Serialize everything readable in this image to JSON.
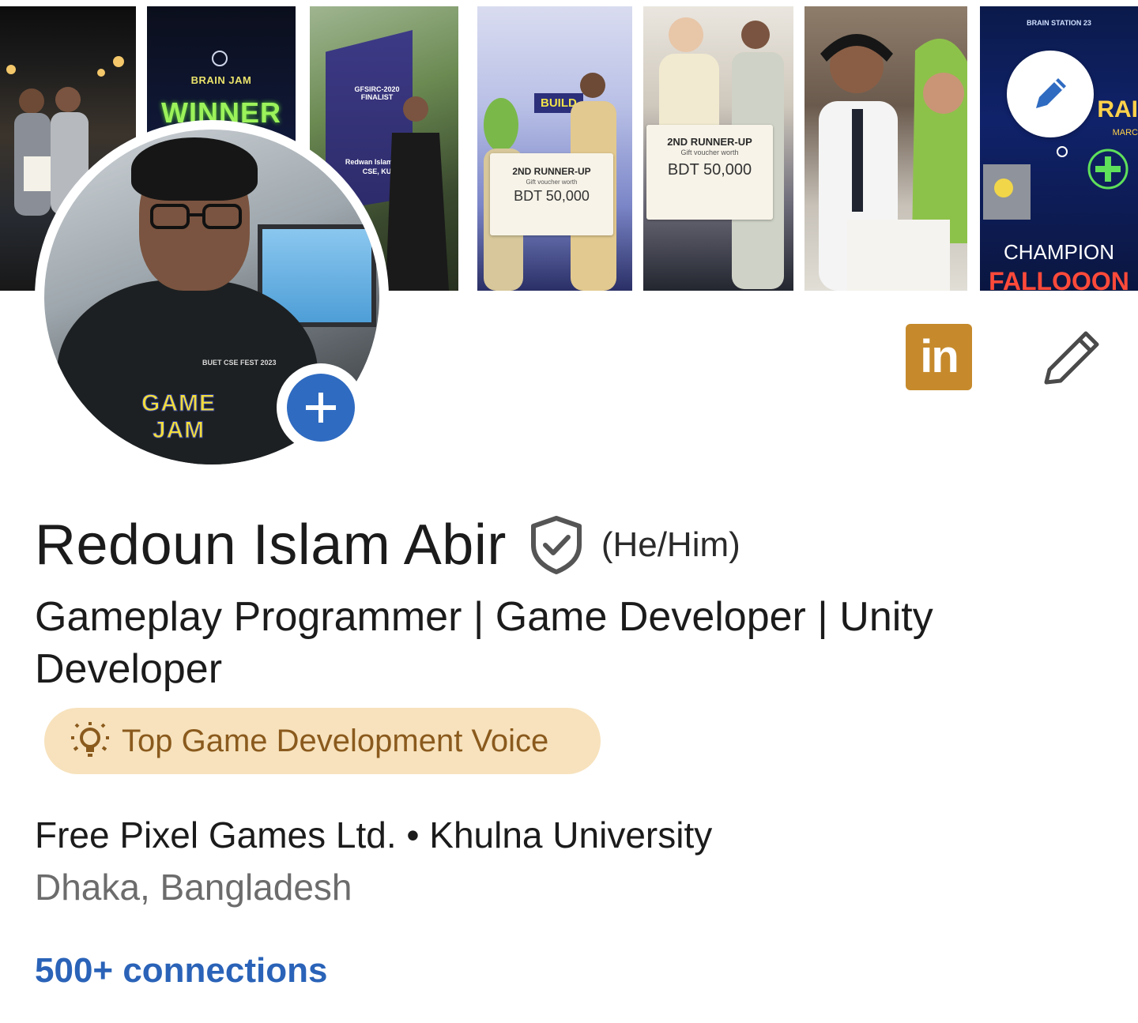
{
  "cover": {
    "brain_jam_title": "BRAIN JAM",
    "brain_jam_winner": "WINNER",
    "gfsirc_text": "GFSIRC-2020 FINALIST",
    "gfsirc_person": "Redwan Islam Abir",
    "gfsirc_dept": "CSE, KU",
    "build_text": "BUILD",
    "card1_title": "2ND RUNNER-UP",
    "card1_sub": "Gift voucher worth",
    "card1_amount": "BDT 50,000",
    "card2_title": "2ND RUNNER-UP",
    "card2_sub": "Gift voucher worth",
    "card2_amount": "BDT 50,000",
    "brainstation_top": "BRAIN STATION 23",
    "brainstation_rai": "RAI",
    "brainstation_marc": "MARC",
    "champion": "CHAMPION",
    "falloon": "FALLOOON"
  },
  "avatar": {
    "tee_top": "BUET CSE FEST 2023",
    "tee_main": "GAME JAM"
  },
  "profile": {
    "name": "Redoun Islam Abir",
    "pronouns": "(He/Him)",
    "headline": "Gameplay Programmer | Game Developer | Unity Developer",
    "voice_badge": "Top Game Development Voice",
    "organizations": "Free Pixel Games Ltd. • Khulna University",
    "location": "Dhaka, Bangladesh",
    "connections": "500+ connections"
  },
  "actions": {
    "linkedin_label": "in"
  },
  "colors": {
    "accent_blue": "#2f6bc1",
    "link_blue": "#2a63b8",
    "voice_bg": "#f7e2bd",
    "voice_text": "#8a5a1d",
    "linkedin_gold": "#c68a2c"
  },
  "icons": {
    "cover_edit": "pencil-icon",
    "add_photo": "plus-icon",
    "verified": "shield-check-icon",
    "voice": "lightbulb-icon",
    "edit_profile": "pencil-icon",
    "linkedin": "linkedin-logo"
  }
}
